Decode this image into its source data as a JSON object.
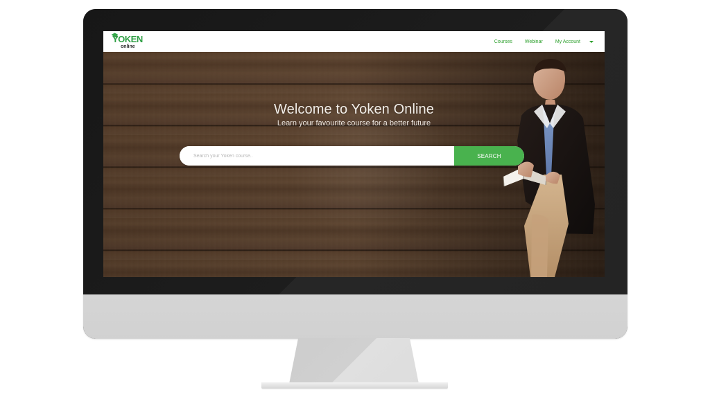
{
  "brand": {
    "logo_text": "YOKEN",
    "logo_subtext": "online",
    "icon": "graduation-cap-icon",
    "brand_color": "#2f9f45"
  },
  "navigation": {
    "items": [
      {
        "label": "Courses"
      },
      {
        "label": "Webinar"
      },
      {
        "label": "My Account"
      }
    ],
    "account_menu_icon": "chevron-down-icon",
    "link_color": "#2b9f2b"
  },
  "hero": {
    "title": "Welcome to Yoken Online",
    "subtitle": "Learn your favourite course for a better future",
    "person_image": "man-reading-book"
  },
  "search": {
    "placeholder": "Search your Yoken course..",
    "button_label": "SEARCH",
    "button_color": "#49b24e"
  },
  "device": {
    "type": "desktop-monitor"
  }
}
